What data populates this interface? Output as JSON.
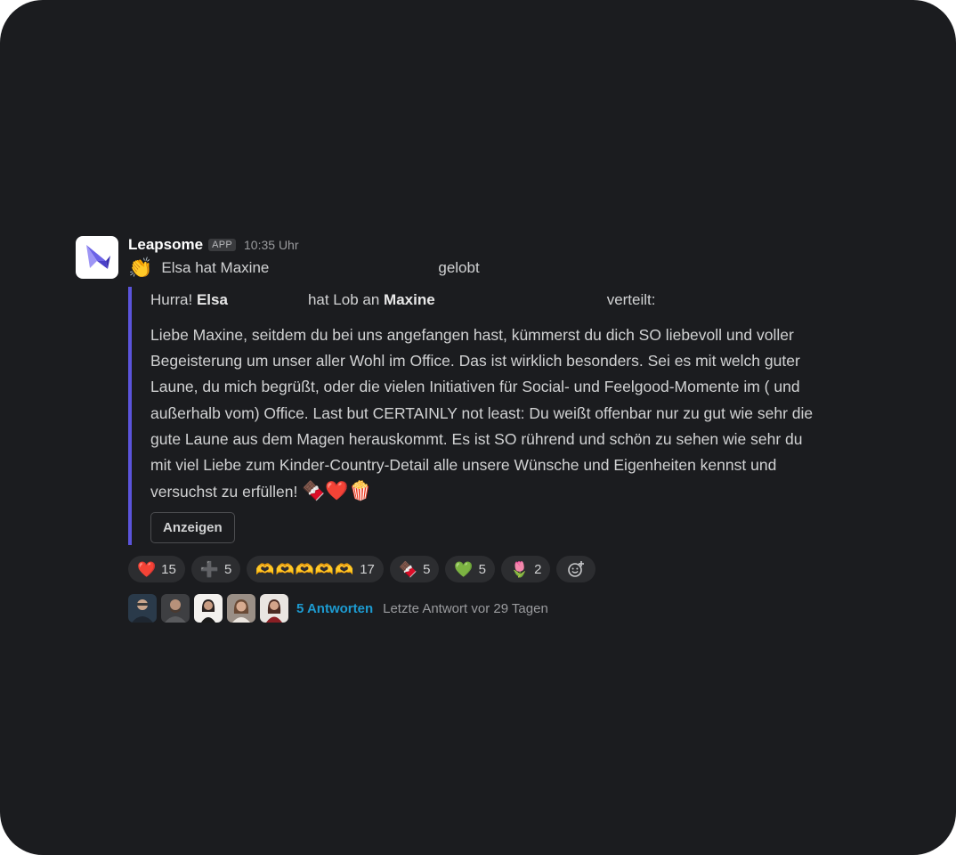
{
  "message": {
    "sender": "Leapsome",
    "badge": "APP",
    "time": "10:35 Uhr",
    "praise_prefix": "Elsa hat Maxine",
    "praise_suffix": "gelobt"
  },
  "attachment": {
    "hurra": "Hurra!",
    "giver": "Elsa",
    "middle": "hat Lob an",
    "receiver": "Maxine",
    "end": "verteilt:",
    "text": "Liebe Maxine, seitdem du bei uns angefangen hast, kümmerst du dich SO liebevoll und voller Begeisterung um unser aller Wohl im Office. Das ist wirklich besonders. Sei es mit welch guter Laune, du mich begrüßt, oder die vielen Initiativen für Social- und Feelgood-Momente im ( und außerhalb vom) Office. Last but CERTAINLY not least: Du weißt offenbar nur zu gut wie sehr die gute Laune aus dem Magen herauskommt. Es ist SO rührend und schön zu sehen wie sehr du mit viel Liebe zum Kinder-Country-Detail alle unsere Wünsche und Eigenheiten kennst und versuchst zu erfüllen!",
    "text_emoji": "🍫❤️🍿",
    "show_button": "Anzeigen"
  },
  "reactions": [
    {
      "emoji": "❤️",
      "count": "15"
    },
    {
      "emoji": "➕",
      "count": "5"
    },
    {
      "emoji": "🫶🫶🫶🫶🫶",
      "count": "17"
    },
    {
      "emoji": "🍫",
      "count": "5"
    },
    {
      "emoji": "💚",
      "count": "5"
    },
    {
      "emoji": "🌷",
      "count": "2"
    }
  ],
  "thread": {
    "replies": "5 Antworten",
    "last_reply": "Letzte Antwort vor 29 Tagen"
  },
  "colors": {
    "background": "#1b1c1f",
    "accent_bar": "#5b54db",
    "link": "#1d9bd1"
  }
}
